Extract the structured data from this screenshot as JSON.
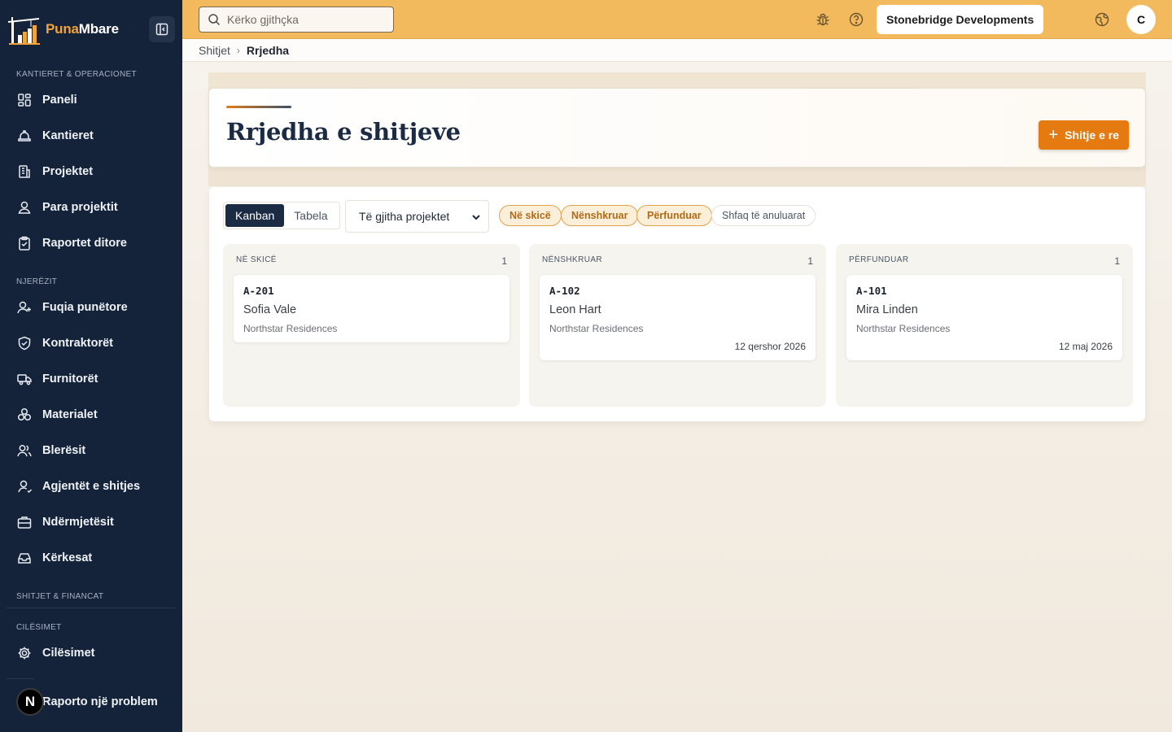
{
  "app": {
    "brand_a": "Puna",
    "brand_b": "Mbare"
  },
  "sidebar": {
    "sections": [
      {
        "label": "KANTIERET & OPERACIONET"
      },
      {
        "label": "NJERËZIT"
      },
      {
        "label": "SHITJET & FINANCAT"
      },
      {
        "label": "CILËSIMET"
      }
    ],
    "items": [
      {
        "label": "Paneli",
        "icon": "dashboard-icon"
      },
      {
        "label": "Kantieret",
        "icon": "hard-hat-icon"
      },
      {
        "label": "Projektet",
        "icon": "building-icon"
      },
      {
        "label": "Para projektit",
        "icon": "user-pin-icon"
      },
      {
        "label": "Raportet ditore",
        "icon": "clipboard-icon"
      },
      {
        "label": "Fuqia punëtore",
        "icon": "user-plus-icon"
      },
      {
        "label": "Kontraktorët",
        "icon": "shield-icon"
      },
      {
        "label": "Furnitorët",
        "icon": "truck-icon"
      },
      {
        "label": "Materialet",
        "icon": "boxes-icon"
      },
      {
        "label": "Blerësit",
        "icon": "users-icon"
      },
      {
        "label": "Agjentët e shitjes",
        "icon": "user-icon"
      },
      {
        "label": "Ndërmjetësit",
        "icon": "briefcase-icon"
      },
      {
        "label": "Kërkesat",
        "icon": "inbox-icon"
      },
      {
        "label": "Cilësimet",
        "icon": "gear-icon"
      }
    ],
    "report": {
      "badge": "N",
      "label": "Raporto një problem"
    }
  },
  "topbar": {
    "search_placeholder": "Kërko gjithçka",
    "company": "Stonebridge Developments",
    "avatar": "C"
  },
  "breadcrumb": {
    "parent": "Shitjet",
    "current": "Rrjedha"
  },
  "page": {
    "title": "Rrjedha e shitjeve",
    "new_button": "Shitje e re"
  },
  "toolbar": {
    "views": [
      "Kanban",
      "Tabela"
    ],
    "active_view": "Kanban",
    "project_filter": "Të gjitha projektet",
    "chips": [
      "Në skicë",
      "Nënshkruar",
      "Përfunduar"
    ],
    "show_cancelled": "Shfaq të anuluarat"
  },
  "columns": [
    {
      "title": "NË SKICË",
      "count": "1",
      "cards": [
        {
          "code": "A-201",
          "buyer": "Sofia Vale",
          "project": "Northstar Residences",
          "date": ""
        }
      ]
    },
    {
      "title": "NËNSHKRUAR",
      "count": "1",
      "cards": [
        {
          "code": "A-102",
          "buyer": "Leon Hart",
          "project": "Northstar Residences",
          "date": "12 qershor 2026"
        }
      ]
    },
    {
      "title": "PËRFUNDUAR",
      "count": "1",
      "cards": [
        {
          "code": "A-101",
          "buyer": "Mira Linden",
          "project": "Northstar Residences",
          "date": "12 maj 2026"
        }
      ]
    }
  ],
  "colors": {
    "sidebar_bg": "#15233a",
    "topbar_bg": "#f2b95d",
    "accent": "#e57a10",
    "navy": "#1b2b44"
  }
}
